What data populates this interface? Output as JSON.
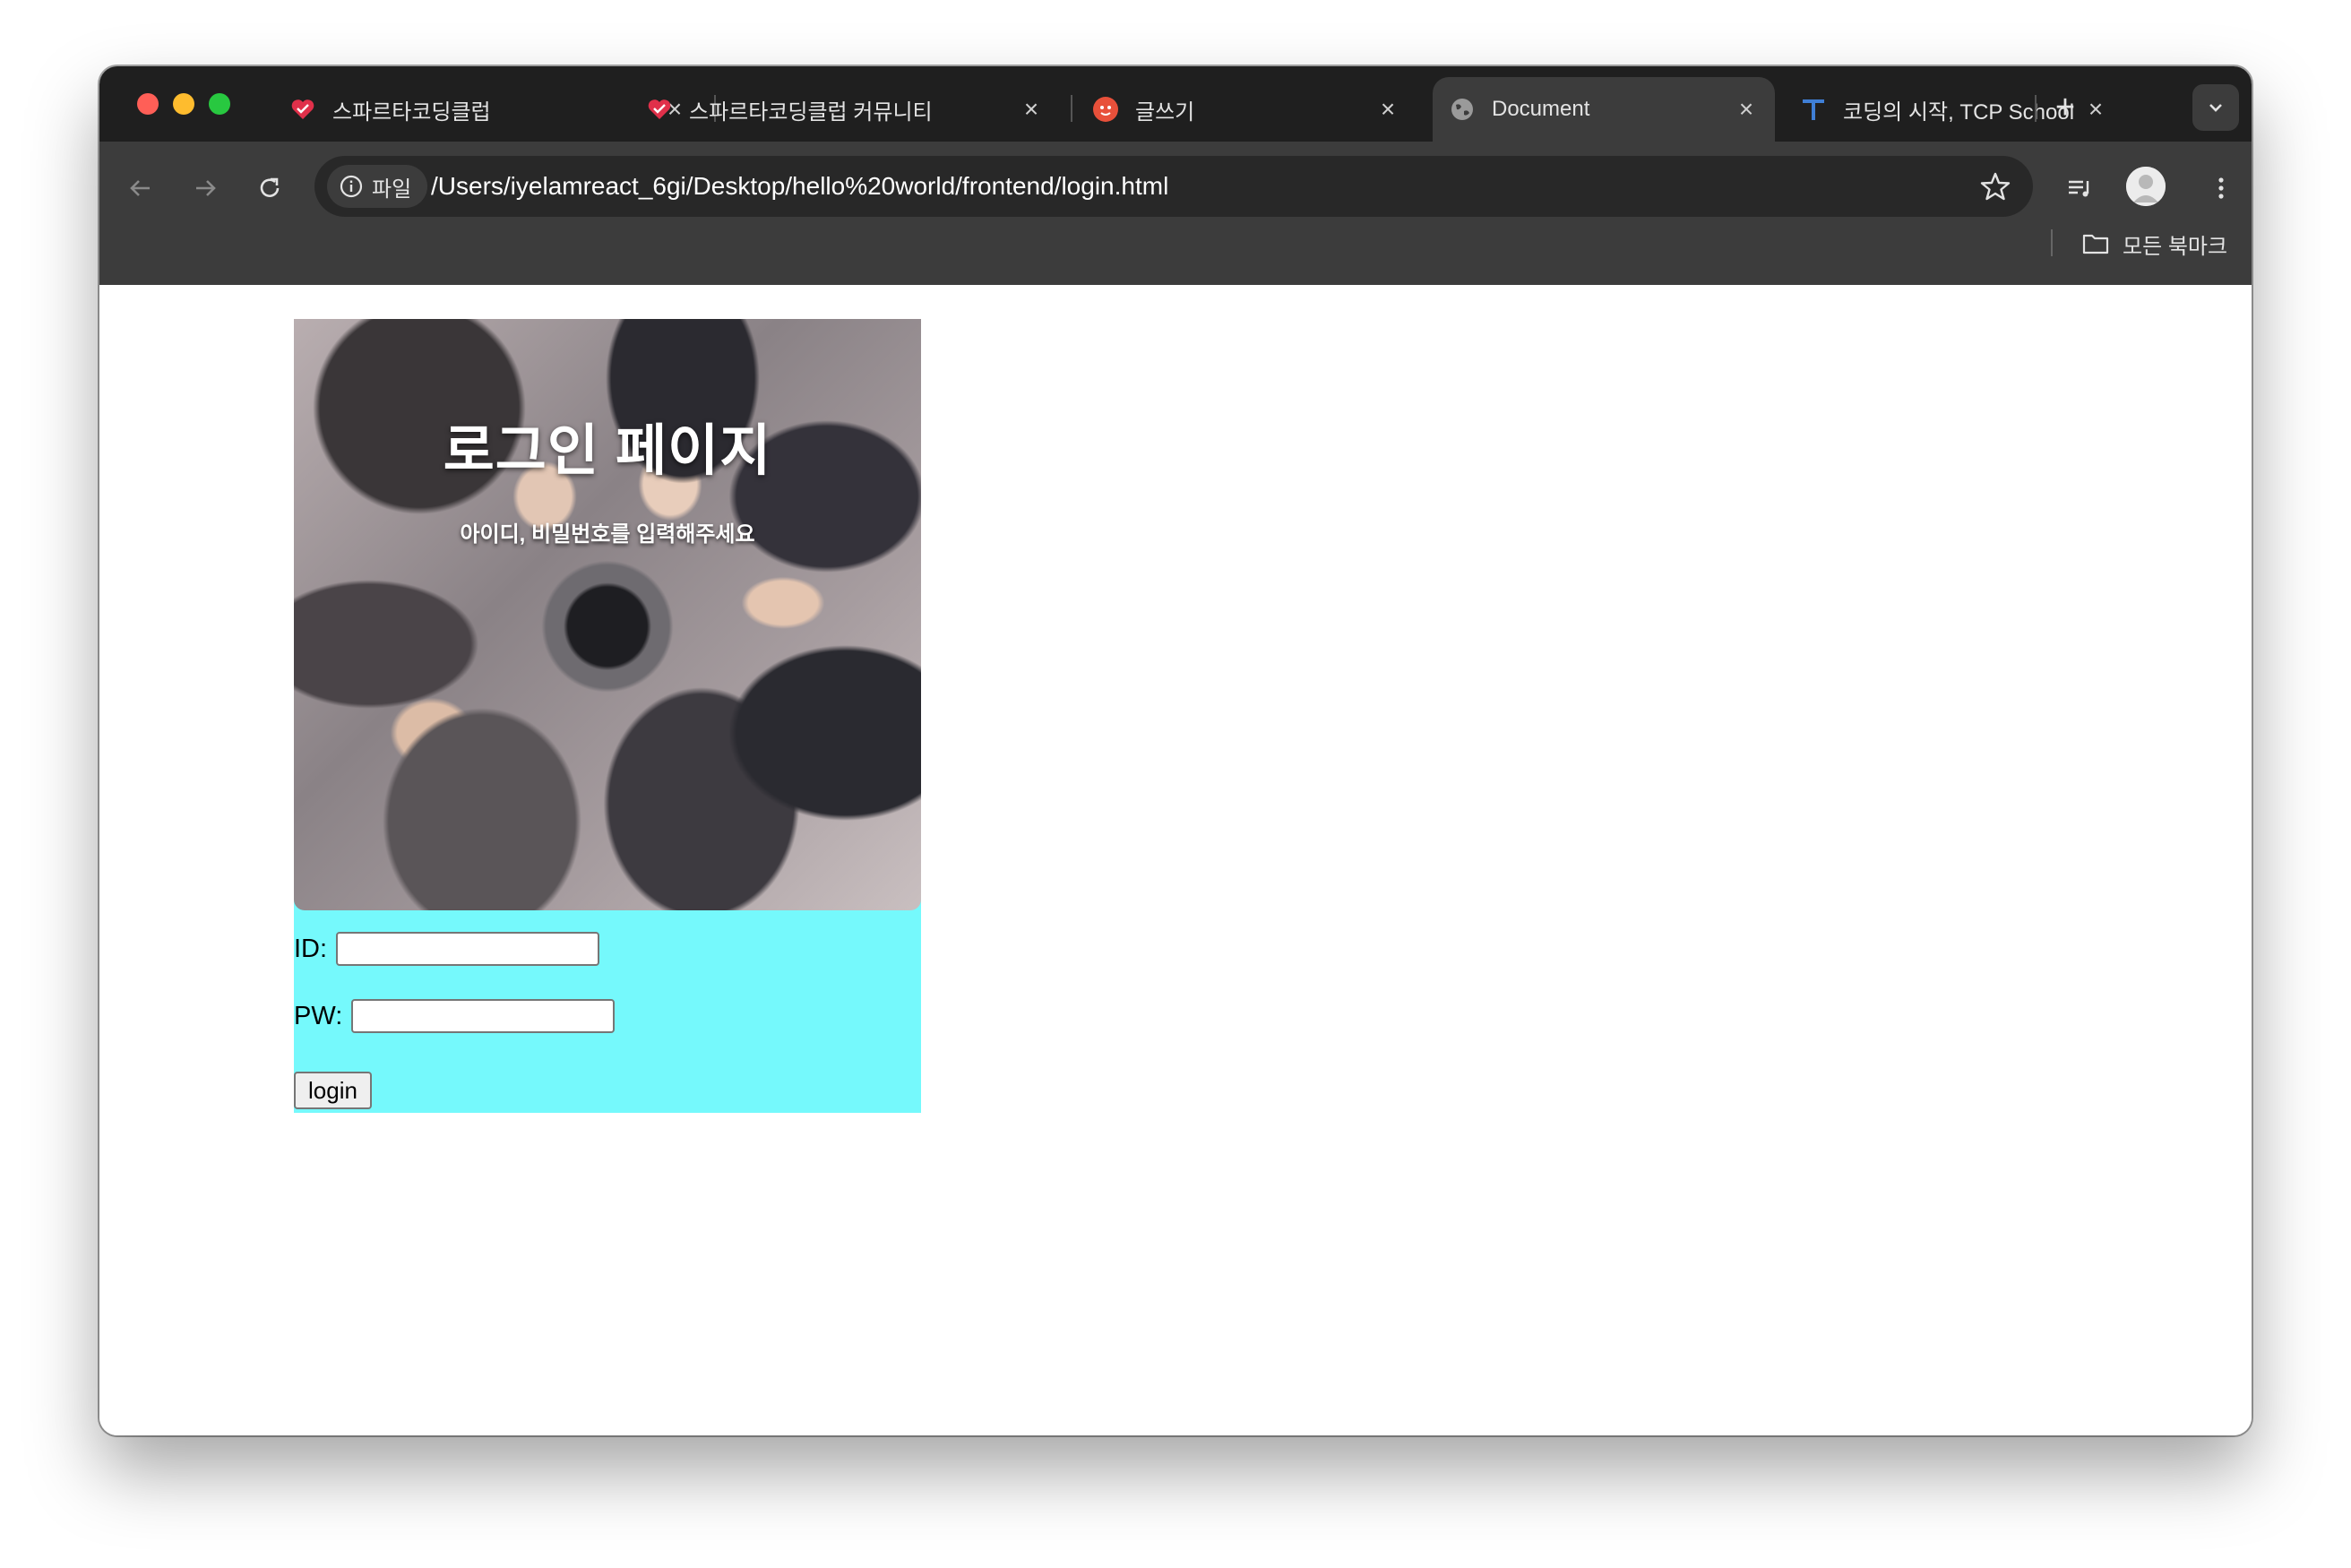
{
  "tabs": [
    {
      "label": "스파르타코딩클럽",
      "favicon": "sparta-heart-icon",
      "active": false
    },
    {
      "label": "스파르타코딩클럽 커뮤니티",
      "favicon": "sparta-heart-icon",
      "active": false
    },
    {
      "label": "글쓰기",
      "favicon": "sparta-circle-icon",
      "active": false
    },
    {
      "label": "Document",
      "favicon": "globe-icon",
      "active": true
    },
    {
      "label": "코딩의 시작, TCP School",
      "favicon": "tcp-school-t-icon",
      "active": false
    }
  ],
  "toolbar": {
    "site_chip": "파일",
    "url": "/Users/iyelamreact_6gi/Desktop/hello%20world/frontend/login.html",
    "bookmarks_label": "모든 북마크"
  },
  "page": {
    "title": "로그인 페이지",
    "subtitle": "아이디, 비밀번호를 입력해주세요",
    "id_label": "ID:",
    "pw_label": "PW:",
    "id_value": "",
    "pw_value": "",
    "login_button": "login"
  },
  "colors": {
    "card_background": "#75f9fc",
    "chrome_dark": "#1f1f1f",
    "toolbar": "#3c3c3c"
  }
}
